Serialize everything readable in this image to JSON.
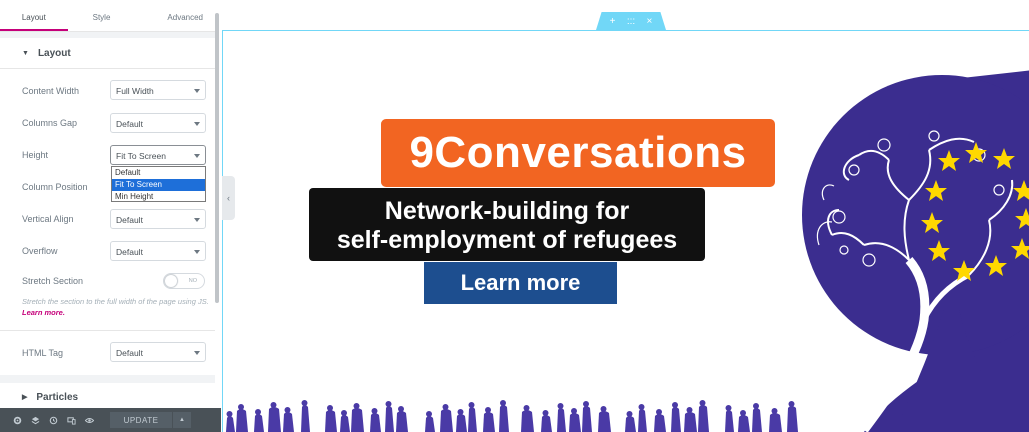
{
  "panel": {
    "tabs": [
      {
        "label": "Layout",
        "active": true
      },
      {
        "label": "Style",
        "active": false
      },
      {
        "label": "Advanced",
        "active": false
      }
    ],
    "layout_section": {
      "title": "Layout",
      "expanded": true
    },
    "controls": {
      "content_width": {
        "label": "Content Width",
        "value": "Full Width"
      },
      "columns_gap": {
        "label": "Columns Gap",
        "value": "Default"
      },
      "height": {
        "label": "Height",
        "value": "Fit To Screen",
        "options": [
          "Default",
          "Fit To Screen",
          "Min Height"
        ],
        "open": true
      },
      "column_position": {
        "label": "Column Position"
      },
      "vertical_align": {
        "label": "Vertical Align",
        "value": "Default"
      },
      "overflow": {
        "label": "Overflow",
        "value": "Default"
      },
      "stretch_section": {
        "label": "Stretch Section",
        "toggle_text": "NO",
        "help": "Stretch the section to the full width of the page using JS.",
        "help_link": "Learn more."
      },
      "html_tag": {
        "label": "HTML Tag",
        "value": "Default"
      }
    },
    "particles_section": {
      "title": "Particles",
      "expanded": false
    },
    "footer": {
      "icons": [
        "gear-icon",
        "layers-icon",
        "history-icon",
        "responsive-icon",
        "eye-icon"
      ],
      "update_label": "UPDATE"
    }
  },
  "canvas": {
    "section_handle": {
      "add": "+",
      "move": ":::",
      "close": "×"
    },
    "collapse_arrow": "‹",
    "banner": {
      "title": "9Conversations",
      "subtitle_line1": "Network-building for",
      "subtitle_line2": "self-employment of refugees",
      "button_label": "Learn more"
    },
    "colors": {
      "title_bg": "#f26522",
      "subtitle_bg": "#111111",
      "button_bg": "#1d4e8f",
      "logo_purple": "#3b2d8f",
      "star_yellow": "#ffd800",
      "section_outline": "#71d7f7",
      "accent": "#c5007a"
    }
  }
}
